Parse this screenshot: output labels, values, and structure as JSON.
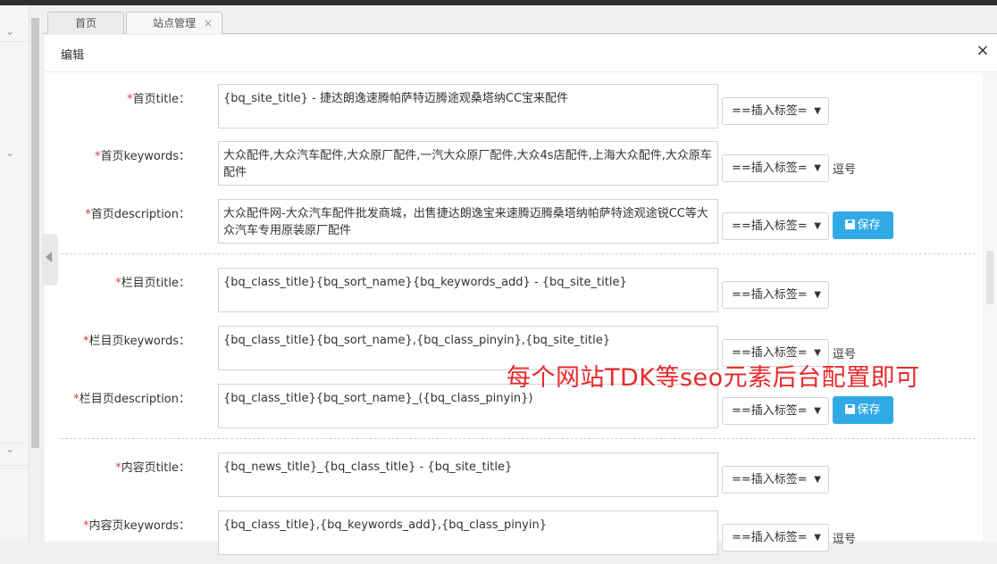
{
  "tabs": {
    "home": "首页",
    "site": "站点管理",
    "close_glyph": "×"
  },
  "panel": {
    "title": "编辑",
    "close_glyph": "×"
  },
  "select_label": "==插入标签=",
  "save_label": "保存",
  "sections": [
    {
      "rows": [
        {
          "label": "首页title：",
          "value": "{bq_site_title} - 捷达朗逸速腾帕萨特迈腾途观桑塔纳CC宝来配件",
          "note": ""
        },
        {
          "label": "首页keywords：",
          "value": "大众配件,大众汽车配件,大众原厂配件,一汽大众原厂配件,大众4s店配件,上海大众配件,大众原车配件",
          "note": "逗号"
        },
        {
          "label": "首页description：",
          "value": "大众配件网-大众汽车配件批发商城，出售捷达朗逸宝来速腾迈腾桑塔纳帕萨特途观途锐CC等大众汽车专用原装原厂配件",
          "note": ""
        }
      ]
    },
    {
      "rows": [
        {
          "label": "栏目页title：",
          "value": "{bq_class_title}{bq_sort_name}{bq_keywords_add} - {bq_site_title}",
          "note": ""
        },
        {
          "label": "栏目页keywords：",
          "value": "{bq_class_title}{bq_sort_name},{bq_class_pinyin},{bq_site_title}",
          "note": "逗号"
        },
        {
          "label": "栏目页description：",
          "value": "{bq_class_title}{bq_sort_name}_({bq_class_pinyin})",
          "note": ""
        }
      ]
    },
    {
      "rows": [
        {
          "label": "内容页title：",
          "value": "{bq_news_title}_{bq_class_title} - {bq_site_title}",
          "note": ""
        },
        {
          "label": "内容页keywords：",
          "value": "{bq_class_title},{bq_keywords_add},{bq_class_pinyin}",
          "note": "逗号"
        }
      ]
    }
  ],
  "overlay_text": "每个网站TDK等seo元素后台配置即可",
  "colors": {
    "accent": "#31a9e6",
    "required": "#e53935",
    "overlay": "#e8292a"
  }
}
